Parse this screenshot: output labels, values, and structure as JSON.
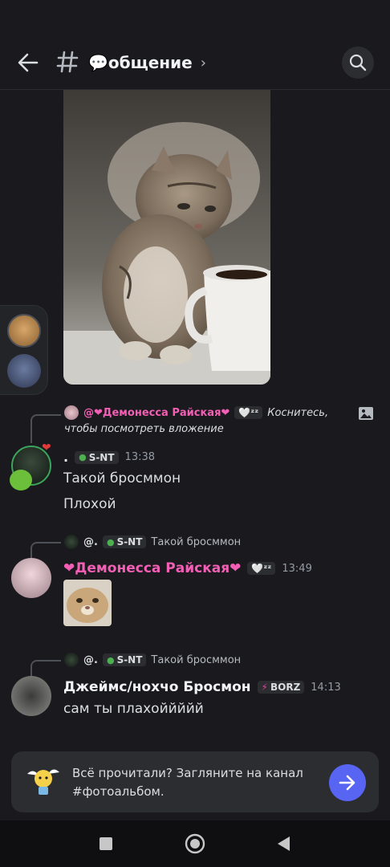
{
  "header": {
    "title": "💬общение",
    "chevron": "›"
  },
  "messages": [
    {
      "reply": {
        "mention": "@❤Демонесса Райская❤",
        "badge_emoji": "🤍ᶻᶻ",
        "text_line1": "Коснитесь,",
        "text_line2": "чтобы посмотреть вложение"
      },
      "author": ".",
      "tag": "S-NT",
      "time": "13:38",
      "lines": [
        "Такой бросммон",
        "Плохой"
      ]
    },
    {
      "reply": {
        "author": "@.",
        "tag": "S-NT",
        "text": "Такой бросммон"
      },
      "author": "❤Демонесса Райская❤",
      "badge_emoji": "🤍ᶻᶻ",
      "time": "13:49"
    },
    {
      "reply": {
        "author": "@.",
        "tag": "S-NT",
        "text": "Такой бросммон"
      },
      "author": "Джеймс/нохчо Бросмон",
      "tag": "BORZ",
      "time": "14:13",
      "lines": [
        "сам ты плахоййййй"
      ]
    }
  ],
  "banner": {
    "text": "Всё прочитали? Загляните на канал #фотоальбом."
  },
  "colors": {
    "accent": "#5865f2",
    "pink_name": "#f25fb4",
    "background": "#1a1a1e"
  }
}
